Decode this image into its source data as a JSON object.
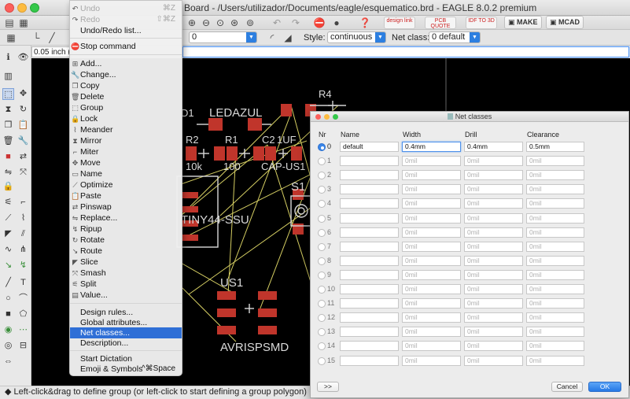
{
  "window": {
    "title": "Board - /Users/utilizador/Documents/eagle/esquematico.brd - EAGLE 8.0.2 premium"
  },
  "toolbar": {
    "badges": [
      "design link",
      "PCB QUOTE",
      "IDF TO 3D"
    ],
    "make_label": "MAKE",
    "mcad_label": "MCAD"
  },
  "parambar": {
    "width_value": "0",
    "style_label": "Style:",
    "style_value": "continuous",
    "netclass_label": "Net class:",
    "netclass_value": "0 default"
  },
  "coordinate": "0.05 inch (",
  "edit_menu": {
    "items": [
      {
        "label": "Undo",
        "shortcut": "⌘Z",
        "disabled": true,
        "icon": "undo-icon"
      },
      {
        "label": "Redo",
        "shortcut": "⇧⌘Z",
        "disabled": true,
        "icon": "redo-icon"
      },
      {
        "label": "Undo/Redo list...",
        "shortcut": "",
        "disabled": false,
        "icon": ""
      },
      {
        "label": "Stop command",
        "shortcut": "",
        "disabled": false,
        "icon": "stop-icon"
      },
      {
        "label": "Add...",
        "shortcut": "",
        "disabled": false,
        "icon": "add-icon"
      },
      {
        "label": "Change...",
        "shortcut": "",
        "disabled": false,
        "icon": "wrench-icon"
      },
      {
        "label": "Copy",
        "shortcut": "",
        "disabled": false,
        "icon": "copy-icon"
      },
      {
        "label": "Delete",
        "shortcut": "",
        "disabled": false,
        "icon": "trash-icon"
      },
      {
        "label": "Group",
        "shortcut": "",
        "disabled": false,
        "icon": "group-icon"
      },
      {
        "label": "Lock",
        "shortcut": "",
        "disabled": false,
        "icon": "lock-icon"
      },
      {
        "label": "Meander",
        "shortcut": "",
        "disabled": false,
        "icon": "meander-icon"
      },
      {
        "label": "Mirror",
        "shortcut": "",
        "disabled": false,
        "icon": "mirror-icon"
      },
      {
        "label": "Miter",
        "shortcut": "",
        "disabled": false,
        "icon": "miter-icon"
      },
      {
        "label": "Move",
        "shortcut": "",
        "disabled": false,
        "icon": "move-icon"
      },
      {
        "label": "Name",
        "shortcut": "",
        "disabled": false,
        "icon": "name-icon"
      },
      {
        "label": "Optimize",
        "shortcut": "",
        "disabled": false,
        "icon": "optimize-icon"
      },
      {
        "label": "Paste",
        "shortcut": "",
        "disabled": false,
        "icon": "paste-icon"
      },
      {
        "label": "Pinswap",
        "shortcut": "",
        "disabled": false,
        "icon": "pinswap-icon"
      },
      {
        "label": "Replace...",
        "shortcut": "",
        "disabled": false,
        "icon": "replace-icon"
      },
      {
        "label": "Ripup",
        "shortcut": "",
        "disabled": false,
        "icon": "ripup-icon"
      },
      {
        "label": "Rotate",
        "shortcut": "",
        "disabled": false,
        "icon": "rotate-icon"
      },
      {
        "label": "Route",
        "shortcut": "",
        "disabled": false,
        "icon": "route-icon"
      },
      {
        "label": "Slice",
        "shortcut": "",
        "disabled": false,
        "icon": "slice-icon"
      },
      {
        "label": "Smash",
        "shortcut": "",
        "disabled": false,
        "icon": "smash-icon"
      },
      {
        "label": "Split",
        "shortcut": "",
        "disabled": false,
        "icon": "split-icon"
      },
      {
        "label": "Value...",
        "shortcut": "",
        "disabled": false,
        "icon": "value-icon"
      },
      {
        "label": "Design rules...",
        "shortcut": "",
        "disabled": false,
        "icon": ""
      },
      {
        "label": "Global attributes...",
        "shortcut": "",
        "disabled": false,
        "icon": ""
      },
      {
        "label": "Net classes...",
        "shortcut": "",
        "disabled": false,
        "icon": "",
        "selected": true
      },
      {
        "label": "Description...",
        "shortcut": "",
        "disabled": false,
        "icon": ""
      },
      {
        "label": "Start Dictation",
        "shortcut": "",
        "disabled": false,
        "icon": ""
      },
      {
        "label": "Emoji & Symbols",
        "shortcut": "^⌘Space",
        "disabled": false,
        "icon": ""
      }
    ]
  },
  "pcb": {
    "labels": [
      "LEDAZUL",
      "R4",
      "R2",
      "R1",
      "C2",
      "1UF",
      "10k",
      "100",
      "CAP-US1",
      "S1",
      "TINY44-SSU",
      "US1",
      "AVRISPSMD",
      "D1"
    ]
  },
  "status_text": "Left-click&drag to define group (or left-click to start defining a group polygon)",
  "net_classes_dialog": {
    "title": "Net classes",
    "headers": {
      "nr": "Nr",
      "name": "Name",
      "width": "Width",
      "drill": "Drill",
      "clearance": "Clearance"
    },
    "rows": [
      {
        "nr": "0",
        "name": "default",
        "width": "0.4mm",
        "drill": "0.4mm",
        "clearance": "0.5mm",
        "selected": true
      },
      {
        "nr": "1",
        "name": "",
        "width": "0mil",
        "drill": "0mil",
        "clearance": "0mil"
      },
      {
        "nr": "2",
        "name": "",
        "width": "0mil",
        "drill": "0mil",
        "clearance": "0mil"
      },
      {
        "nr": "3",
        "name": "",
        "width": "0mil",
        "drill": "0mil",
        "clearance": "0mil"
      },
      {
        "nr": "4",
        "name": "",
        "width": "0mil",
        "drill": "0mil",
        "clearance": "0mil"
      },
      {
        "nr": "5",
        "name": "",
        "width": "0mil",
        "drill": "0mil",
        "clearance": "0mil"
      },
      {
        "nr": "6",
        "name": "",
        "width": "0mil",
        "drill": "0mil",
        "clearance": "0mil"
      },
      {
        "nr": "7",
        "name": "",
        "width": "0mil",
        "drill": "0mil",
        "clearance": "0mil"
      },
      {
        "nr": "8",
        "name": "",
        "width": "0mil",
        "drill": "0mil",
        "clearance": "0mil"
      },
      {
        "nr": "9",
        "name": "",
        "width": "0mil",
        "drill": "0mil",
        "clearance": "0mil"
      },
      {
        "nr": "10",
        "name": "",
        "width": "0mil",
        "drill": "0mil",
        "clearance": "0mil"
      },
      {
        "nr": "11",
        "name": "",
        "width": "0mil",
        "drill": "0mil",
        "clearance": "0mil"
      },
      {
        "nr": "12",
        "name": "",
        "width": "0mil",
        "drill": "0mil",
        "clearance": "0mil"
      },
      {
        "nr": "13",
        "name": "",
        "width": "0mil",
        "drill": "0mil",
        "clearance": "0mil"
      },
      {
        "nr": "14",
        "name": "",
        "width": "0mil",
        "drill": "0mil",
        "clearance": "0mil"
      },
      {
        "nr": "15",
        "name": "",
        "width": "0mil",
        "drill": "0mil",
        "clearance": "0mil"
      }
    ],
    "more_label": ">>",
    "cancel_label": "Cancel",
    "ok_label": "OK"
  },
  "colors": {
    "pad_red": "#c0352b",
    "airwire_yellow": "#d6cf63",
    "silkscreen": "#d9d9d9",
    "selection_blue": "#2f6fd6"
  }
}
